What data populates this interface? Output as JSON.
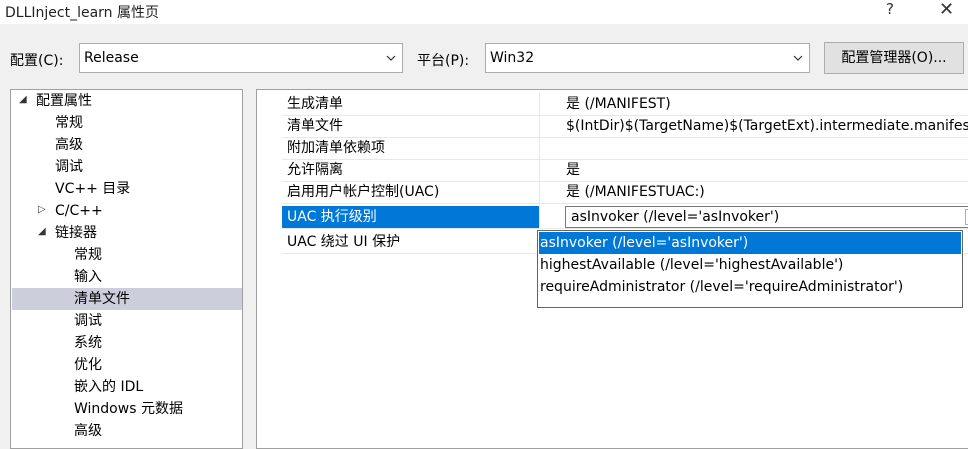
{
  "window": {
    "title": "DLLInject_learn 属性页",
    "help_glyph": "?",
    "close_glyph": "✕"
  },
  "toolbar": {
    "config_label": "配置(C):",
    "config_value": "Release",
    "platform_label": "平台(P):",
    "platform_value": "Win32",
    "config_manager_label": "配置管理器(O)..."
  },
  "tree": {
    "items": [
      {
        "label": "配置属性",
        "toggle": "◢"
      },
      {
        "label": "常规"
      },
      {
        "label": "高级"
      },
      {
        "label": "调试"
      },
      {
        "label": "VC++ 目录"
      },
      {
        "label": "C/C++",
        "toggle": "▷"
      },
      {
        "label": "链接器",
        "toggle": "◢"
      },
      {
        "label": "常规"
      },
      {
        "label": "输入"
      },
      {
        "label": "清单文件",
        "selected": true
      },
      {
        "label": "调试"
      },
      {
        "label": "系统"
      },
      {
        "label": "优化"
      },
      {
        "label": "嵌入的 IDL"
      },
      {
        "label": "Windows 元数据"
      },
      {
        "label": "高级"
      }
    ]
  },
  "properties": {
    "rows": [
      {
        "name": "生成清单",
        "value": "是 (/MANIFEST)"
      },
      {
        "name": "清单文件",
        "value": "$(IntDir)$(TargetName)$(TargetExt).intermediate.manifest"
      },
      {
        "name": "附加清单依赖项",
        "value": ""
      },
      {
        "name": "允许隔离",
        "value": "是"
      },
      {
        "name": "启用用户帐户控制(UAC)",
        "value": "是 (/MANIFESTUAC:)"
      },
      {
        "name": "UAC 执行级别",
        "value": "asInvoker (/level='asInvoker')",
        "selected": true
      },
      {
        "name": "UAC 绕过 UI 保护",
        "value": ""
      }
    ]
  },
  "dropdown": {
    "options": [
      {
        "label": "asInvoker (/level='asInvoker')",
        "highlighted": true
      },
      {
        "label": "highestAvailable (/level='highestAvailable')"
      },
      {
        "label": "requireAdministrator (/level='requireAdministrator')"
      }
    ]
  }
}
